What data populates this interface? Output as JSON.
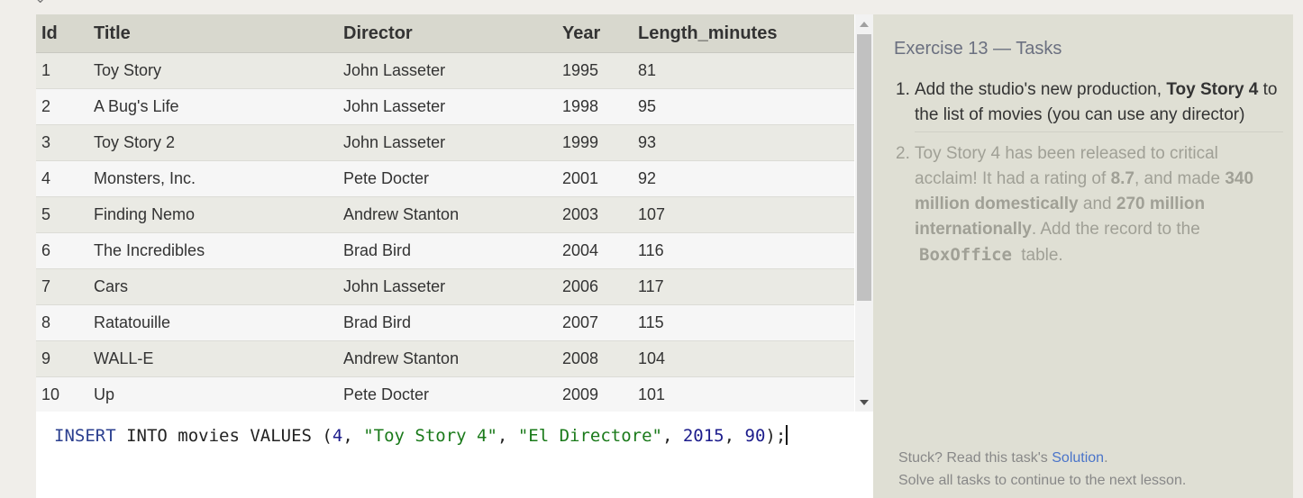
{
  "table": {
    "columns": [
      "Id",
      "Title",
      "Director",
      "Year",
      "Length_minutes"
    ],
    "rows": [
      [
        "1",
        "Toy Story",
        "John Lasseter",
        "1995",
        "81"
      ],
      [
        "2",
        "A Bug's Life",
        "John Lasseter",
        "1998",
        "95"
      ],
      [
        "3",
        "Toy Story 2",
        "John Lasseter",
        "1999",
        "93"
      ],
      [
        "4",
        "Monsters, Inc.",
        "Pete Docter",
        "2001",
        "92"
      ],
      [
        "5",
        "Finding Nemo",
        "Andrew Stanton",
        "2003",
        "107"
      ],
      [
        "6",
        "The Incredibles",
        "Brad Bird",
        "2004",
        "116"
      ],
      [
        "7",
        "Cars",
        "John Lasseter",
        "2006",
        "117"
      ],
      [
        "8",
        "Ratatouille",
        "Brad Bird",
        "2007",
        "115"
      ],
      [
        "9",
        "WALL-E",
        "Andrew Stanton",
        "2008",
        "104"
      ],
      [
        "10",
        "Up",
        "Pete Docter",
        "2009",
        "101"
      ]
    ]
  },
  "editor": {
    "tokens": [
      {
        "t": "INSERT",
        "c": "kw"
      },
      {
        "t": " INTO movies VALUES (",
        "c": ""
      },
      {
        "t": "4",
        "c": "num"
      },
      {
        "t": ", ",
        "c": ""
      },
      {
        "t": "\"Toy Story 4\"",
        "c": "str"
      },
      {
        "t": ", ",
        "c": ""
      },
      {
        "t": "\"El Directore\"",
        "c": "str"
      },
      {
        "t": ", ",
        "c": ""
      },
      {
        "t": "2015",
        "c": "num"
      },
      {
        "t": ", ",
        "c": ""
      },
      {
        "t": "90",
        "c": "num"
      },
      {
        "t": ");",
        "c": ""
      }
    ]
  },
  "tasks": {
    "title": "Exercise 13 — Tasks",
    "items": [
      {
        "number": "1.",
        "parts": [
          {
            "t": "Add the studio's new production, ",
            "b": false
          },
          {
            "t": "Toy Story 4",
            "b": true
          },
          {
            "t": " to the list of movies (you can use any director)",
            "b": false
          }
        ]
      },
      {
        "number": "2.",
        "parts": [
          {
            "t": "Toy Story 4 has been released to critical acclaim! It had a rating of ",
            "b": false
          },
          {
            "t": "8.7",
            "b": true
          },
          {
            "t": ", and made ",
            "b": false
          },
          {
            "t": "340 million domestically",
            "b": true
          },
          {
            "t": " and ",
            "b": false
          },
          {
            "t": "270 million internationally",
            "b": true
          },
          {
            "t": ". Add the record to the ",
            "b": false
          },
          {
            "t": "BoxOffice",
            "b": "mono"
          },
          {
            "t": " table.",
            "b": false
          }
        ]
      }
    ]
  },
  "footer": {
    "stuck_prefix": "Stuck? Read this task's ",
    "solution_link": "Solution",
    "stuck_suffix": ".",
    "continue_text": "Solve all tasks to continue to the next lesson."
  }
}
